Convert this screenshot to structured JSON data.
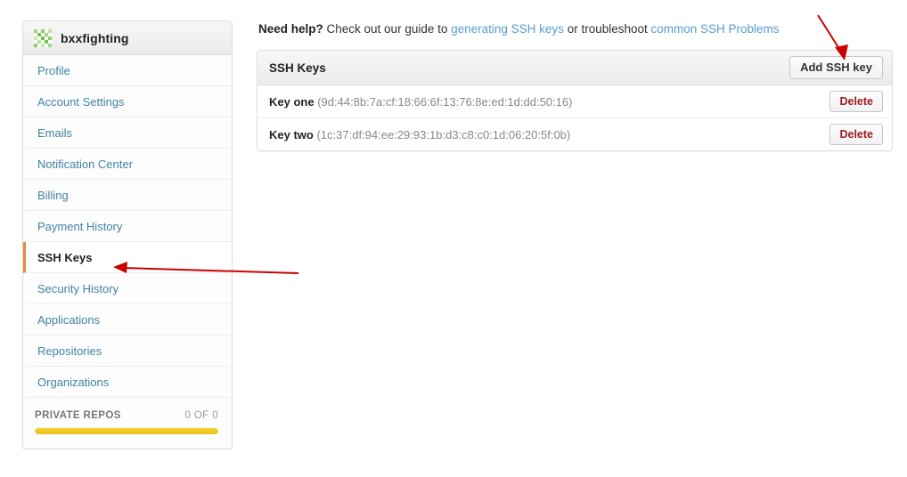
{
  "sidebar": {
    "username": "bxxfighting",
    "avatar_icon": "identicon-avatar-icon",
    "items": [
      {
        "label": "Profile",
        "active": false
      },
      {
        "label": "Account Settings",
        "active": false
      },
      {
        "label": "Emails",
        "active": false
      },
      {
        "label": "Notification Center",
        "active": false
      },
      {
        "label": "Billing",
        "active": false
      },
      {
        "label": "Payment History",
        "active": false
      },
      {
        "label": "SSH Keys",
        "active": true
      },
      {
        "label": "Security History",
        "active": false
      },
      {
        "label": "Applications",
        "active": false
      },
      {
        "label": "Repositories",
        "active": false
      },
      {
        "label": "Organizations",
        "active": false
      }
    ],
    "private_repos": {
      "label": "PRIVATE REPOS",
      "count": "0 OF 0",
      "fill_percent": 100,
      "fill_color": "#e8c41c"
    }
  },
  "main": {
    "help": {
      "strong": "Need help?",
      "text_1": " Check out our guide to ",
      "link_1": "generating SSH keys",
      "text_2": " or troubleshoot ",
      "link_2": "common SSH Problems",
      "link_color": "#5a9ccf"
    },
    "panel": {
      "title": "SSH Keys",
      "add_button": "Add SSH key",
      "keys": [
        {
          "name": "Key one",
          "fingerprint": "(9d:44:8b:7a:cf:18:66:6f:13:76:8e:ed:1d:dd:50:16)",
          "delete_label": "Delete"
        },
        {
          "name": "Key two",
          "fingerprint": "(1c:37:df:94:ee:29:93:1b:d3:c8:c0:1d:06:20:5f:0b)",
          "delete_label": "Delete"
        }
      ]
    }
  },
  "annotations": {
    "color": "#cc0000",
    "arrow_to_add_button": "arrow-pointing-to-add-ssh-key-button",
    "arrow_to_ssh_keys_nav": "arrow-pointing-to-ssh-keys-sidebar-item"
  }
}
